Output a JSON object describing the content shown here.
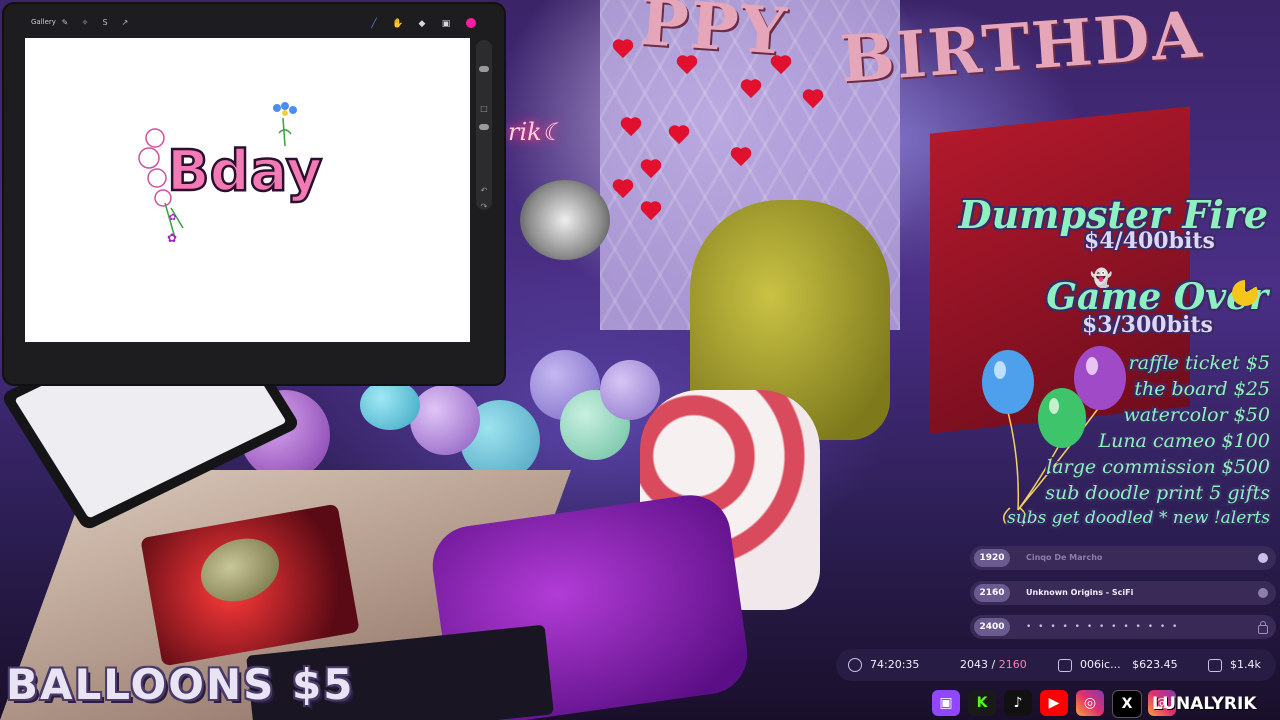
{
  "procreate": {
    "gallery_label": "Gallery",
    "artwork_text": "Bday"
  },
  "goals": {
    "goal1": {
      "title": "Dumpster Fire",
      "progress_text": "$4/400bits",
      "current": 4,
      "target": 400
    },
    "goal2": {
      "title": "Game Over",
      "progress_text": "$3/300bits",
      "current": 3,
      "target": 300
    }
  },
  "price_list": [
    "raffle ticket $5",
    "the board $25",
    "watercolor $50",
    "Luna cameo $100",
    "large commission $500",
    "sub doodle print 5 gifts",
    "subs get doodled * new !alerts"
  ],
  "widget_rows": [
    {
      "number": "1920",
      "text": "Cinqo De Marcho",
      "state": "dim",
      "end": "dot"
    },
    {
      "number": "2160",
      "text": "Unknown Origins - SciFi",
      "state": "active",
      "end": "dot"
    },
    {
      "number": "2400",
      "text": "",
      "state": "locked",
      "end": "lock"
    }
  ],
  "stats": {
    "timer": "74:20:35",
    "count_current": "2043",
    "count_separator": "/",
    "count_total": "2160",
    "wallet_id": "006ic...",
    "wallet_amount": "$623.45",
    "total_amount": "$1.4k"
  },
  "bottom_left_text": "BALLOONS $5",
  "socials": {
    "icons": [
      "twitch-icon",
      "kick-icon",
      "tiktok-icon",
      "youtube-icon",
      "instagram-icon",
      "x-icon",
      "instagram-icon"
    ],
    "handle": "LUNALYRIK"
  },
  "colors": {
    "goal_text": "#8ef0c0",
    "procreate_color": "#ff1aa0",
    "accent_pink": "#ff7fb4"
  }
}
